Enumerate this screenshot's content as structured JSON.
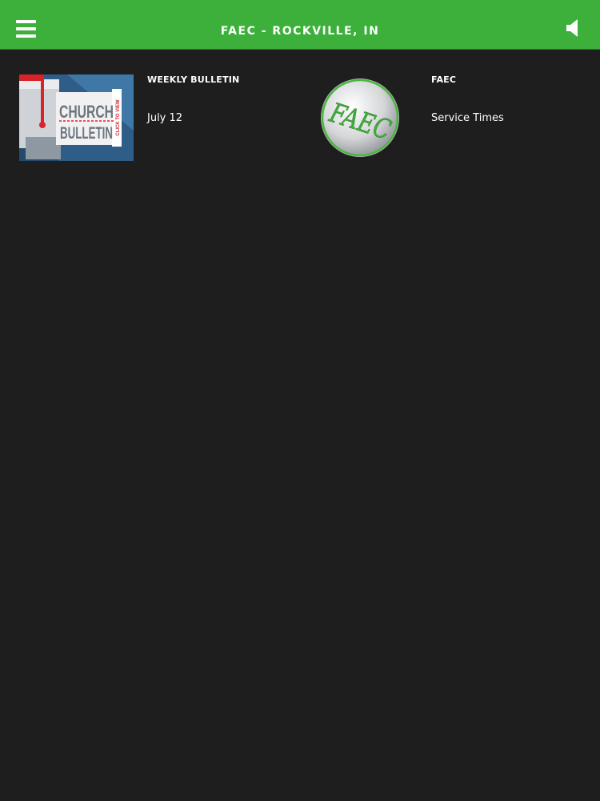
{
  "header": {
    "title": "FAEC - ROCKVILLE, IN",
    "menu_icon": "hamburger-menu-icon",
    "sound_icon": "speaker-icon",
    "bg_color": "#3cb03b"
  },
  "cards": [
    {
      "label": "WEEKLY BULLETIN",
      "subtitle": "July 12",
      "thumb": {
        "line1": "CHURCH",
        "line2": "BULLETIN",
        "side": "CLICK TO VIEW"
      }
    },
    {
      "label": "FAEC",
      "subtitle": "Service Times",
      "thumb": {
        "logo": "FAEC"
      }
    }
  ]
}
